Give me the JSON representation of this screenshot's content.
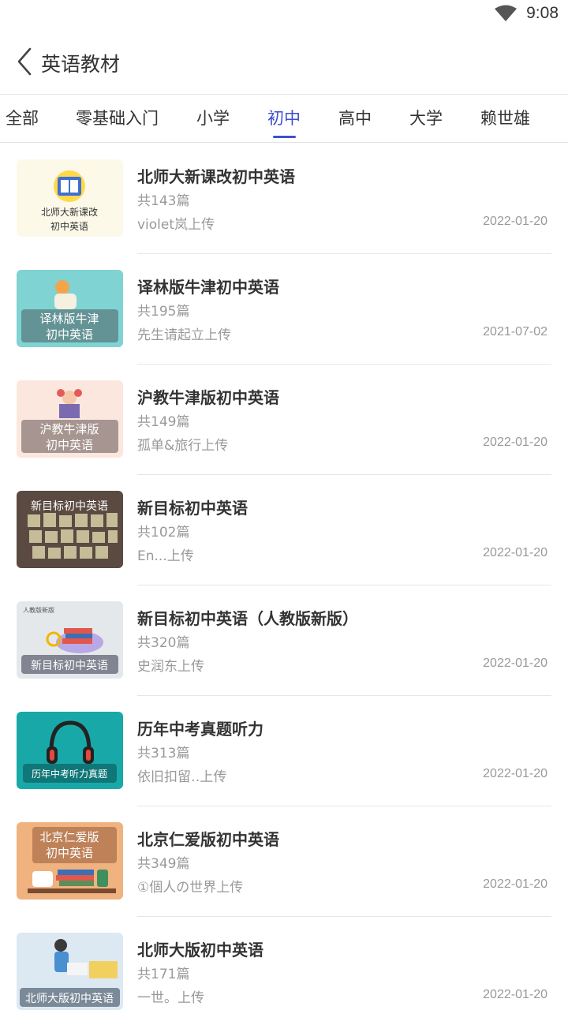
{
  "status_bar": {
    "time": "9:08",
    "wifi_icon": "wifi-icon"
  },
  "header": {
    "title": "英语教材",
    "back_icon": "chevron-left-icon"
  },
  "tabs": [
    {
      "label": "全部"
    },
    {
      "label": "零基础入门"
    },
    {
      "label": "小学"
    },
    {
      "label": "初中",
      "active": true
    },
    {
      "label": "高中"
    },
    {
      "label": "大学"
    },
    {
      "label": "赖世雄"
    }
  ],
  "colors": {
    "accent": "#3f4fcf",
    "muted_text": "#999999",
    "title_text": "#333333"
  },
  "books": [
    {
      "title": "北师大新课改初中英语",
      "count": "共143篇",
      "uploader": "violet岚上传",
      "date": "2022-01-20",
      "cover_text": [
        "北师大新课改",
        "初中英语"
      ]
    },
    {
      "title": "译林版牛津初中英语",
      "count": "共195篇",
      "uploader": "先生请起立上传",
      "date": "2021-07-02",
      "cover_text": [
        "译林版牛津",
        "初中英语"
      ]
    },
    {
      "title": "沪教牛津版初中英语",
      "count": "共149篇",
      "uploader": "孤单&旅行上传",
      "date": "2022-01-20",
      "cover_text": [
        "沪教牛津版",
        "初中英语"
      ]
    },
    {
      "title": "新目标初中英语",
      "count": "共102篇",
      "uploader": "En...上传",
      "date": "2022-01-20",
      "cover_text": [
        "新目标初中英语"
      ]
    },
    {
      "title": "新目标初中英语（人教版新版）",
      "count": "共320篇",
      "uploader": "史润东上传",
      "date": "2022-01-20",
      "cover_text": [
        "人教版新版",
        "新目标初中英语"
      ]
    },
    {
      "title": "历年中考真题听力",
      "count": "共313篇",
      "uploader": "依旧扣留‥上传",
      "date": "2022-01-20",
      "cover_text": [
        "历年中考听力真题"
      ]
    },
    {
      "title": "北京仁爱版初中英语",
      "count": "共349篇",
      "uploader": "①個人の世界上传",
      "date": "2022-01-20",
      "cover_text": [
        "北京仁爱版",
        "初中英语"
      ]
    },
    {
      "title": "北师大版初中英语",
      "count": "共171篇",
      "uploader": "一世。上传",
      "date": "2022-01-20",
      "cover_text": [
        "北师大版初中英语"
      ]
    }
  ]
}
